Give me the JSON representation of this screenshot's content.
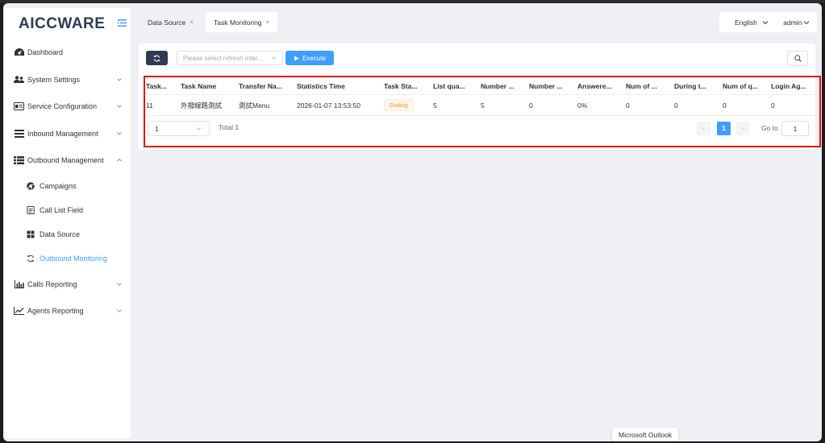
{
  "app": {
    "logo_text": "AICCWARE",
    "colors": {
      "primary": "#409eff",
      "dark": "#2f3b52",
      "highlight": "#e01010",
      "warning": "#e6a23c"
    }
  },
  "tabs": [
    {
      "label": "Data Source",
      "close": "×"
    },
    {
      "label": "Task Monitoring",
      "close": "×"
    }
  ],
  "header": {
    "language": "English",
    "user": "admin"
  },
  "sidebar": {
    "items": [
      {
        "label": "Dashboard",
        "icon": "dashboard-icon"
      },
      {
        "label": "System Settings",
        "icon": "users-gear-icon"
      },
      {
        "label": "Service Configuration",
        "icon": "id-card-icon"
      },
      {
        "label": "Inbound Management",
        "icon": "list-icon"
      },
      {
        "label": "Outbound Management",
        "icon": "table-list-icon"
      },
      {
        "label": "Calls Reporting",
        "icon": "bar-chart-icon"
      },
      {
        "label": "Agents Reporting",
        "icon": "line-chart-icon"
      }
    ],
    "sub_items": [
      {
        "label": "Campaigns",
        "icon": "chrome-icon"
      },
      {
        "label": "Call List Field",
        "icon": "file-list-icon"
      },
      {
        "label": "Data Source",
        "icon": "grid-icon"
      },
      {
        "label": "Outbound Monitoring",
        "icon": "refresh-icon",
        "active": true
      }
    ]
  },
  "toolbar": {
    "refresh_placeholder": "Please select refresh inter...",
    "execute_label": "Execute"
  },
  "table": {
    "headers": [
      "Task...",
      "Task Name",
      "Transfer Na...",
      "Statistics Time",
      "Task Sta...",
      "List qua...",
      "Number ...",
      "Number ...",
      "Answere...",
      "Num of ...",
      "During t...",
      "Num of q...",
      "Login Ag..."
    ],
    "rows": [
      [
        "11",
        "外撥線路測試",
        "測試Menu",
        "2026-01-07 13:53:50",
        "Dialing",
        "5",
        "5",
        "0",
        "0%",
        "0",
        "0",
        "0",
        "0"
      ]
    ]
  },
  "pagination": {
    "page_size": "1",
    "total": "Total 1",
    "prev": "‹",
    "current": "1",
    "next": "›",
    "goto_label": "Go to",
    "goto_value": "1"
  },
  "tooltip": {
    "text": "Microsoft Outlook"
  }
}
